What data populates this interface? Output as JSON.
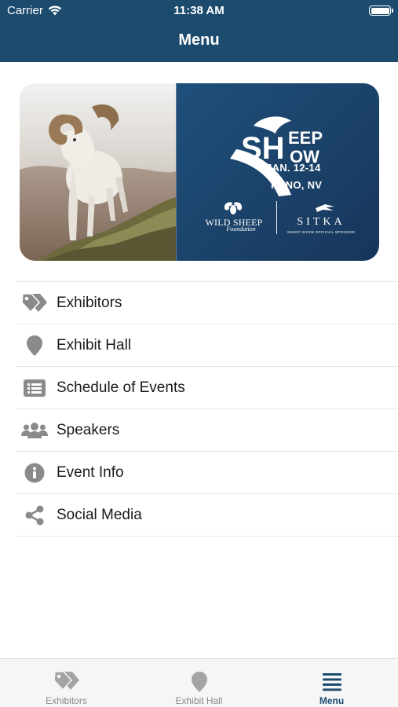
{
  "status_bar": {
    "carrier": "Carrier",
    "time": "11:38 AM"
  },
  "nav": {
    "title": "Menu"
  },
  "banner": {
    "logo_word_1": "SH",
    "logo_word_2": "EEP",
    "logo_word_3": "OW",
    "dates": "JAN. 12-14",
    "city": "RENO, NV",
    "sponsor_1_name": "WILD SHEEP",
    "sponsor_1_sub": "Foundation",
    "sponsor_2_name": "SITKA",
    "sponsor_2_sub": "SHEEP SHOW OFFICIAL SPONSOR"
  },
  "menu": {
    "items": [
      {
        "label": "Exhibitors",
        "icon": "tags-icon"
      },
      {
        "label": "Exhibit Hall",
        "icon": "map-pin-icon"
      },
      {
        "label": "Schedule of Events",
        "icon": "list-icon"
      },
      {
        "label": "Speakers",
        "icon": "users-icon"
      },
      {
        "label": "Event Info",
        "icon": "info-icon"
      },
      {
        "label": "Social Media",
        "icon": "share-icon"
      }
    ]
  },
  "tabbar": {
    "tabs": [
      {
        "label": "Exhibitors",
        "icon": "tags-icon",
        "active": false
      },
      {
        "label": "Exhibit Hall",
        "icon": "map-pin-icon",
        "active": false
      },
      {
        "label": "Menu",
        "icon": "menu-icon",
        "active": true
      }
    ]
  },
  "colors": {
    "header": "#1c4b6e",
    "icon_gray": "#8a8a8a",
    "active_tab": "#1c4b6e",
    "tab_gray": "#a4a4a4"
  }
}
